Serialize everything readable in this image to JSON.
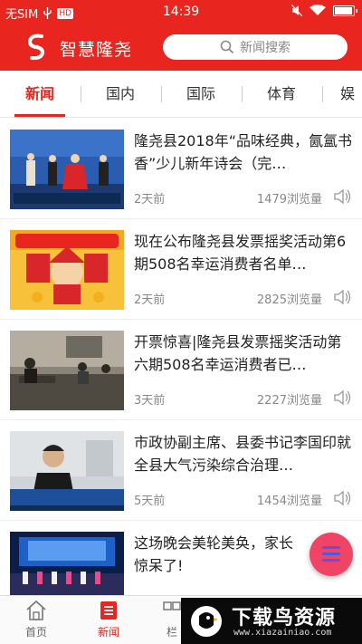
{
  "status_bar": {
    "carrier": "无SIM",
    "hd_badge": "HD",
    "time": "14:39"
  },
  "header": {
    "app_title": "智慧隆尧",
    "search_placeholder": "新闻搜索"
  },
  "tabs": [
    {
      "label": "新闻",
      "active": true
    },
    {
      "label": "国内",
      "active": false
    },
    {
      "label": "国际",
      "active": false
    },
    {
      "label": "体育",
      "active": false
    },
    {
      "label": "娱",
      "active": false
    }
  ],
  "news": [
    {
      "title": "隆尧县2018年“品味经典，氤氲书香”少儿新年诗会（完…",
      "time": "2天前",
      "views": "1479浏览量"
    },
    {
      "title": "现在公布隆尧县发票摇奖活动第6期508名幸运消费者名单…",
      "time": "2天前",
      "views": "2825浏览量"
    },
    {
      "title": "开票惊喜|隆尧县发票摇奖活动第六期508名幸运消费者已…",
      "time": "3天前",
      "views": "2227浏览量"
    },
    {
      "title": "市政协副主席、县委书记李国印就全县大气污染综合治理…",
      "time": "5天前",
      "views": "1454浏览量"
    },
    {
      "title": "这场晚会美轮美奂，家长惊呆了!",
      "time": "",
      "views": ""
    }
  ],
  "bottom_nav": [
    {
      "label": "首页",
      "icon": "home-icon",
      "active": false
    },
    {
      "label": "新闻",
      "icon": "news-icon",
      "active": true
    },
    {
      "label": "栏",
      "icon": "column-icon",
      "active": false
    }
  ],
  "watermark": {
    "title": "下载鸟资源",
    "url": "www.xiazainiao.com"
  },
  "colors": {
    "brand_red": "#e8251e",
    "fab_pink": "#f04466"
  }
}
